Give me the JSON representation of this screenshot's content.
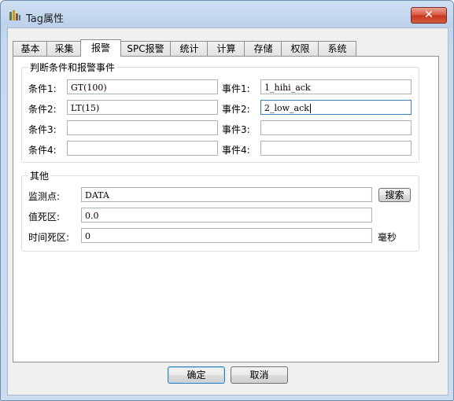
{
  "window": {
    "title": "Tag属性",
    "close_icon": "close-icon",
    "app_icon": "tag-app-icon"
  },
  "tabs": [
    {
      "label": "基本"
    },
    {
      "label": "采集"
    },
    {
      "label": "报警"
    },
    {
      "label": "SPC报警"
    },
    {
      "label": "统计"
    },
    {
      "label": "计算"
    },
    {
      "label": "存储"
    },
    {
      "label": "权限"
    },
    {
      "label": "系统"
    }
  ],
  "active_tab": "报警",
  "alarm_group": {
    "title": "判断条件和报警事件",
    "conditions": [
      {
        "label": "条件1:",
        "value": "GT(100)"
      },
      {
        "label": "条件2:",
        "value": "LT(15)"
      },
      {
        "label": "条件3:",
        "value": ""
      },
      {
        "label": "条件4:",
        "value": ""
      }
    ],
    "events": [
      {
        "label": "事件1:",
        "value": "1_hihi_ack"
      },
      {
        "label": "事件2:",
        "value": "2_low_ack"
      },
      {
        "label": "事件3:",
        "value": ""
      },
      {
        "label": "事件4:",
        "value": ""
      }
    ]
  },
  "other_group": {
    "title": "其他",
    "monitor_label": "监测点:",
    "monitor_value": "DATA",
    "search_label": "搜索",
    "deadband_label": "值死区:",
    "deadband_value": "0.0",
    "time_deadband_label": "时间死区:",
    "time_deadband_value": "0",
    "time_unit": "毫秒"
  },
  "footer": {
    "ok_label": "确定",
    "cancel_label": "取消"
  }
}
